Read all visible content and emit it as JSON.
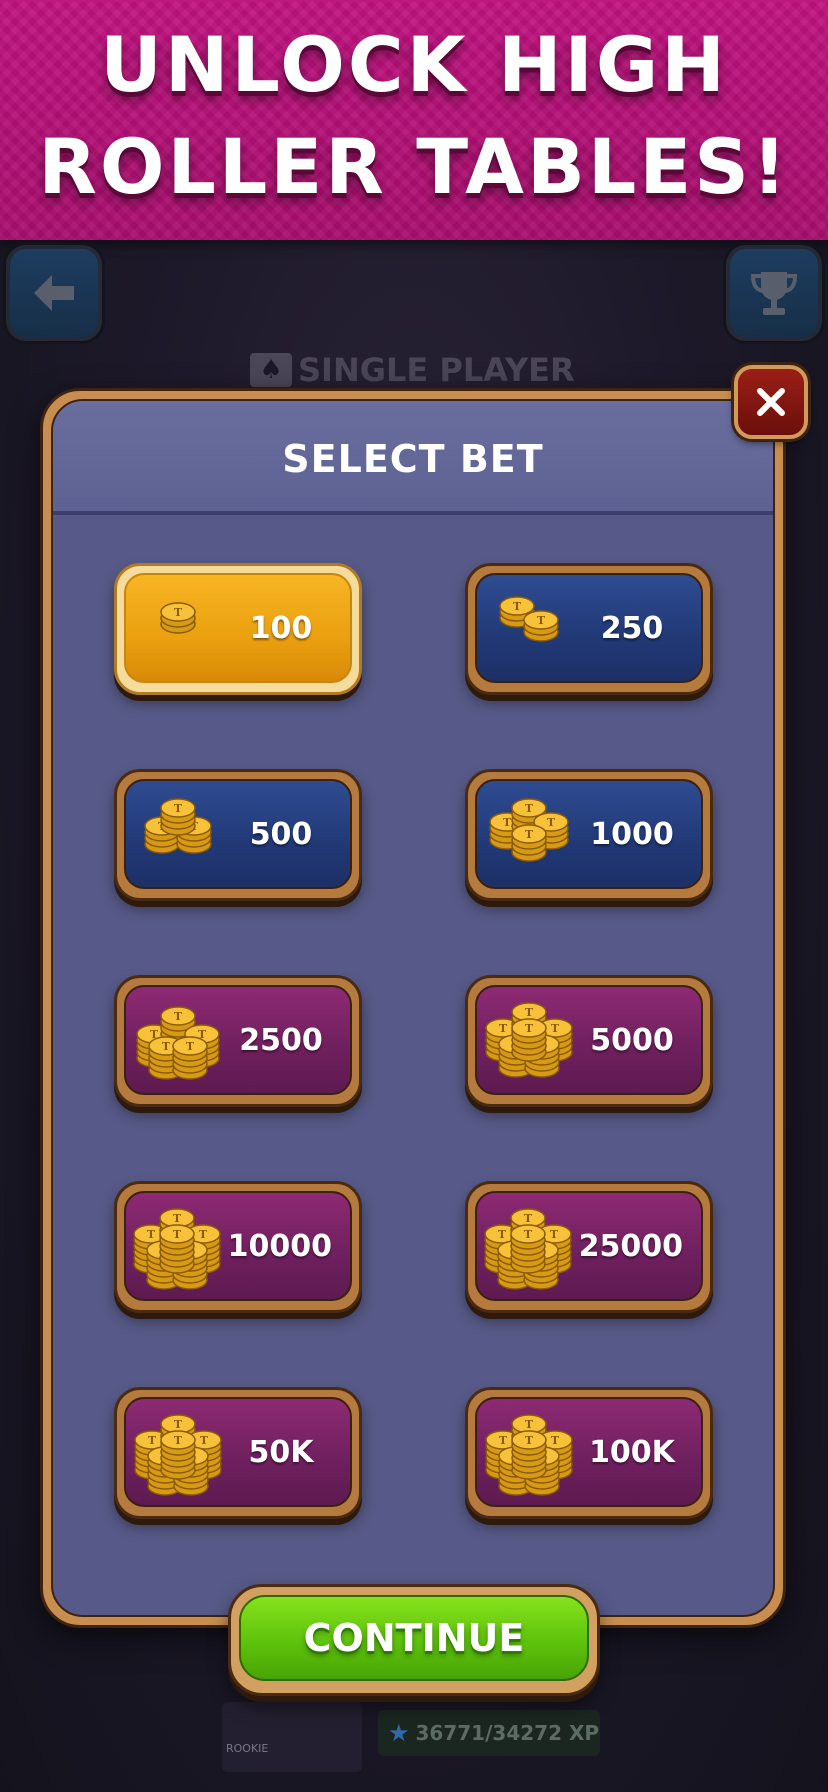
{
  "banner": {
    "line1": "UNLOCK HIGH",
    "line2": "ROLLER TABLES!"
  },
  "background": {
    "mode_title": "SINGLE PLAYER",
    "rank_label": "ROOKIE",
    "xp_text": "36771/34272 XP"
  },
  "modal": {
    "title": "SELECT BET",
    "close_glyph": "✕"
  },
  "bets": [
    {
      "amount": "100",
      "style": "gold",
      "selected": true
    },
    {
      "amount": "250",
      "style": "blue",
      "selected": false
    },
    {
      "amount": "500",
      "style": "blue",
      "selected": false
    },
    {
      "amount": "1000",
      "style": "blue",
      "selected": false
    },
    {
      "amount": "2500",
      "style": "purple",
      "selected": false
    },
    {
      "amount": "5000",
      "style": "purple",
      "selected": false
    },
    {
      "amount": "10000",
      "style": "purple",
      "selected": false
    },
    {
      "amount": "25000",
      "style": "purple",
      "selected": false
    },
    {
      "amount": "50K",
      "style": "purple",
      "selected": false
    },
    {
      "amount": "100K",
      "style": "purple",
      "selected": false
    }
  ],
  "continue_label": "CONTINUE",
  "colors": {
    "banner": "#b5107a",
    "selected_bet": "#eaa00f",
    "blue_bet": "#223a78",
    "purple_bet": "#70205f",
    "continue": "#5ec30c",
    "panel": "#575a88"
  },
  "icons": {
    "back": "arrow-left-icon",
    "trophy": "trophy-icon",
    "close": "close-icon",
    "coin": "coin-stack-icon"
  }
}
